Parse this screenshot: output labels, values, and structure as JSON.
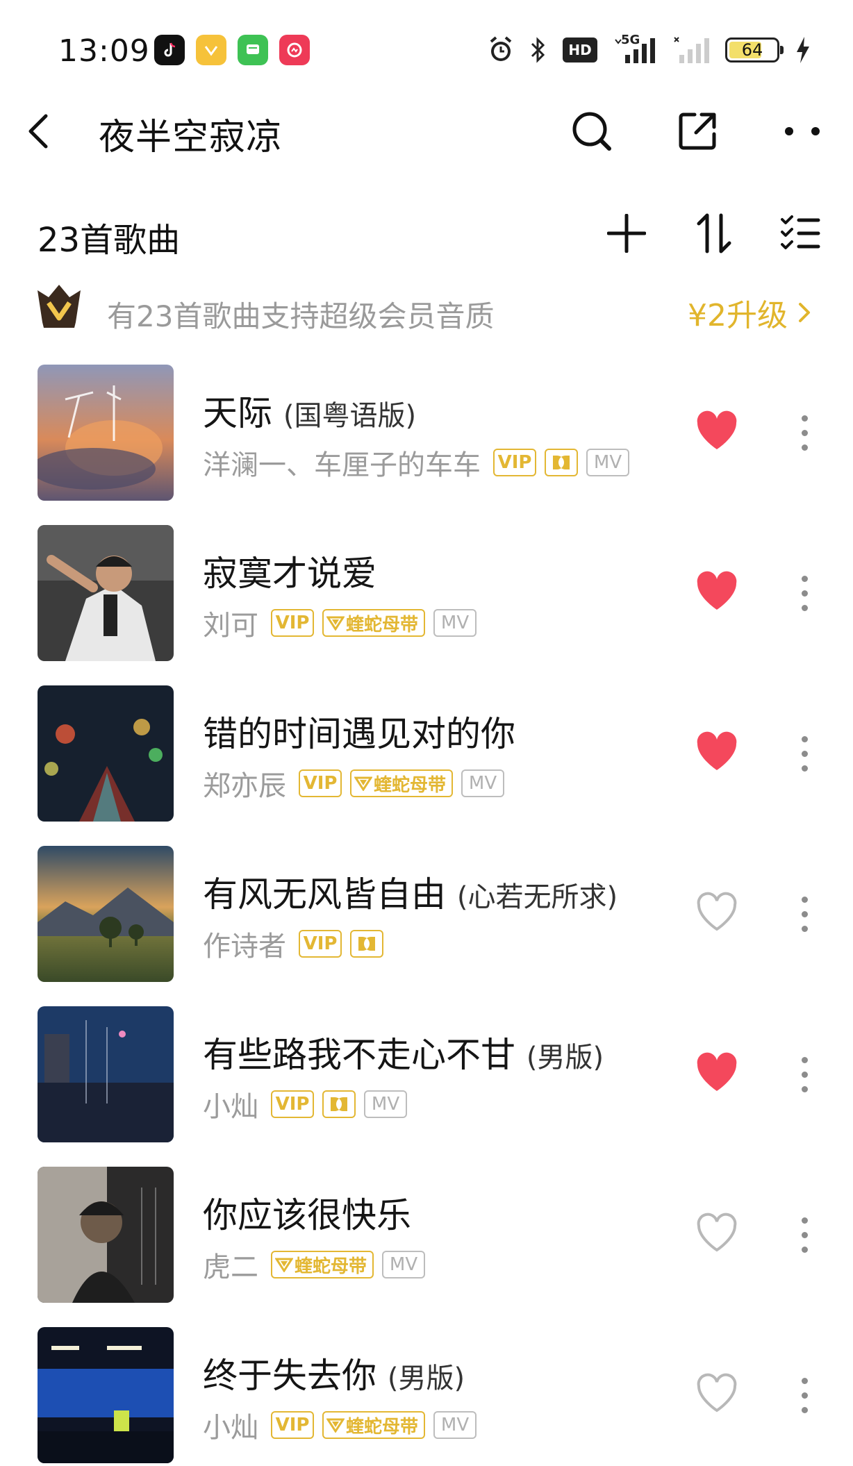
{
  "status_bar": {
    "time": "13:09",
    "network_5g": "5G",
    "hd_label": "HD",
    "battery": "64",
    "battery_level": 0.64
  },
  "nav": {
    "title": "夜半空寂凉",
    "back_icon": "chevron-left-icon",
    "search_icon": "search-icon",
    "share_icon": "share-icon",
    "more_icon": "more-horizontal-icon"
  },
  "list_header": {
    "count_label": "23首歌曲",
    "add_icon": "plus-icon",
    "sort_icon": "sort-icon",
    "manage_icon": "checklist-icon"
  },
  "vip_banner": {
    "text": "有23首歌曲支持超级会员音质",
    "upgrade_label": "¥2升级",
    "accent_color": "#e1b52c"
  },
  "colors": {
    "heart_filled": "#f4485c",
    "heart_outline": "#b8b8b8",
    "tag_gold": "#e3b733",
    "tag_gray": "#bdbdbd"
  },
  "tag_labels": {
    "vip": "VIP",
    "mv": "MV",
    "viper": "蝰蛇母带"
  },
  "songs": [
    {
      "title": "天际",
      "subtitle": "(国粤语版)",
      "artist": "洋澜一、车厘子的车车",
      "vip": true,
      "dolby": true,
      "viper": false,
      "mv": true,
      "liked": true
    },
    {
      "title": "寂寞才说爱",
      "subtitle": "",
      "artist": "刘可",
      "vip": true,
      "dolby": false,
      "viper": true,
      "mv": true,
      "liked": true
    },
    {
      "title": "错的时间遇见对的你",
      "subtitle": "",
      "artist": "郑亦辰",
      "vip": true,
      "dolby": false,
      "viper": true,
      "mv": true,
      "liked": true
    },
    {
      "title": "有风无风皆自由",
      "subtitle": "(心若无所求)",
      "artist": "作诗者",
      "vip": true,
      "dolby": true,
      "viper": false,
      "mv": false,
      "liked": false
    },
    {
      "title": "有些路我不走心不甘",
      "subtitle": "(男版)",
      "artist": "小灿",
      "vip": true,
      "dolby": true,
      "viper": false,
      "mv": true,
      "liked": true
    },
    {
      "title": "你应该很快乐",
      "subtitle": "",
      "artist": "虎二",
      "vip": false,
      "dolby": false,
      "viper": true,
      "mv": true,
      "liked": false
    },
    {
      "title": "终于失去你",
      "subtitle": "(男版)",
      "artist": "小灿",
      "vip": true,
      "dolby": false,
      "viper": true,
      "mv": true,
      "liked": false
    }
  ]
}
